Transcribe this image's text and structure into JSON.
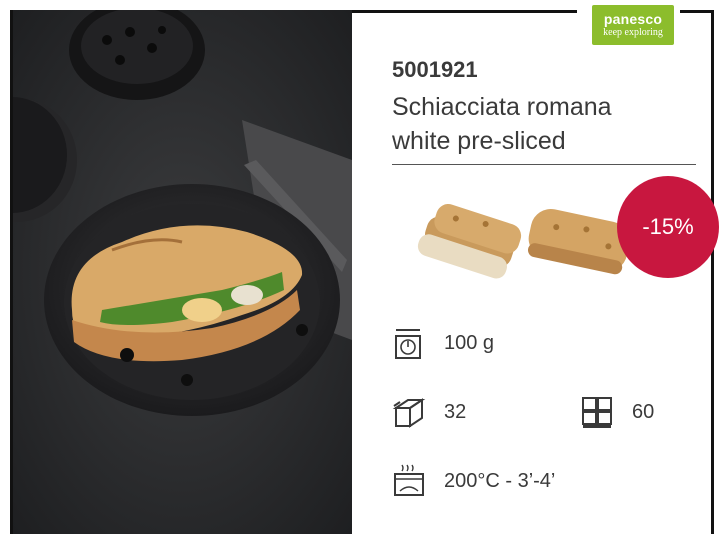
{
  "brand": {
    "name": "panesco",
    "tagline": "keep exploring",
    "color": "#8cbd2c"
  },
  "product": {
    "code": "5001921",
    "name_line1": "Schiacciata romana",
    "name_line2": "white pre-sliced",
    "discount": "-15%",
    "discount_color": "#c8173f"
  },
  "specs": {
    "weight": "100 g",
    "pieces_per_box": "32",
    "boxes_per_pallet": "60",
    "bake": "200°C - 3’-4’"
  },
  "icons": {
    "weight": "scale-icon",
    "box": "box-icon",
    "pallet": "pallet-icon",
    "oven": "oven-icon"
  }
}
